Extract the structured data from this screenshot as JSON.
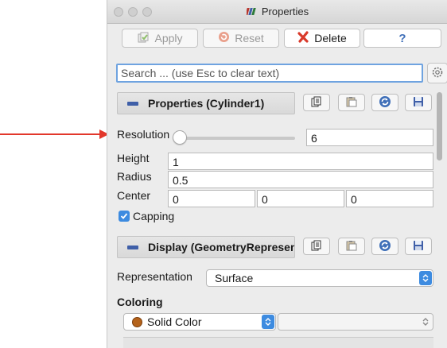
{
  "window": {
    "title": "Properties"
  },
  "toolbar": {
    "apply_label": "Apply",
    "reset_label": "Reset",
    "delete_label": "Delete",
    "help_label": "?"
  },
  "search": {
    "placeholder": "Search ... (use Esc to clear text)"
  },
  "properties_section": {
    "title": "Properties (Cylinder1)",
    "resolution": {
      "label": "Resolution",
      "value": "6"
    },
    "height": {
      "label": "Height",
      "value": "1"
    },
    "radius": {
      "label": "Radius",
      "value": "0.5"
    },
    "center": {
      "label": "Center",
      "values": [
        "0",
        "0",
        "0"
      ]
    },
    "capping": {
      "label": "Capping",
      "checked": true
    }
  },
  "display_section": {
    "title": "Display (GeometryRepresent",
    "representation": {
      "label": "Representation",
      "value": "Surface"
    },
    "coloring": {
      "label": "Coloring",
      "value": "Solid Color"
    }
  },
  "colors": {
    "accent": "#3d8be0",
    "annotation_arrow": "#e2372b",
    "delete_red": "#d93a2b",
    "header_icon": "#3f5fa8"
  }
}
